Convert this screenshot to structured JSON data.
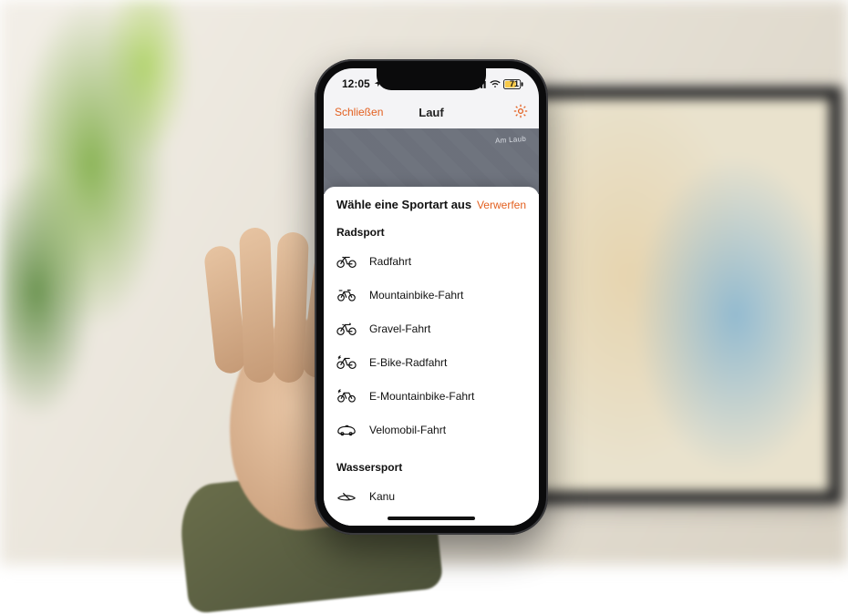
{
  "status_bar": {
    "time": "12:05",
    "battery_percent": "71"
  },
  "nav": {
    "close": "Schließen",
    "title": "Lauf",
    "settings_icon": "gear"
  },
  "map": {
    "street_label": "Am Laub"
  },
  "sheet": {
    "title": "Wähle eine Sportart aus",
    "dismiss": "Verwerfen",
    "sections": [
      {
        "title": "Radsport",
        "items": [
          {
            "icon": "bike",
            "label": "Radfahrt"
          },
          {
            "icon": "mtb",
            "label": "Mountainbike-Fahrt"
          },
          {
            "icon": "gravel-bike",
            "label": "Gravel-Fahrt"
          },
          {
            "icon": "ebike",
            "label": "E-Bike-Radfahrt"
          },
          {
            "icon": "e-mtb",
            "label": "E-Mountainbike-Fahrt"
          },
          {
            "icon": "velomobile",
            "label": "Velomobil-Fahrt"
          }
        ]
      },
      {
        "title": "Wassersport",
        "items": [
          {
            "icon": "canoe",
            "label": "Kanu"
          }
        ]
      }
    ]
  },
  "colors": {
    "accent": "#e35f1e"
  }
}
